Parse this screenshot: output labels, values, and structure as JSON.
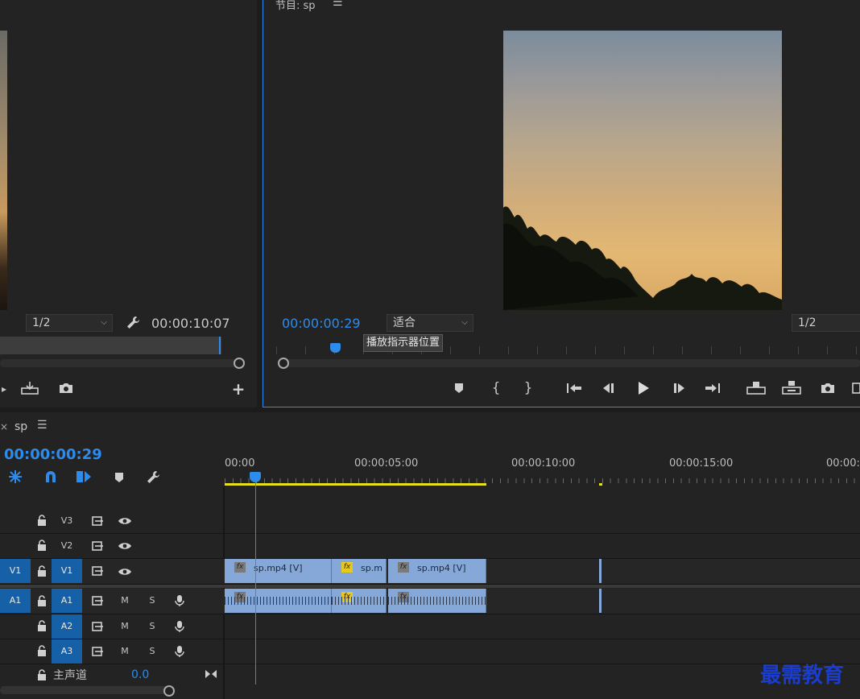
{
  "source_monitor": {
    "zoom": "1/2",
    "timecode": "00:00:10:07"
  },
  "program_monitor": {
    "title": "节目: sp",
    "timecode": "00:00:00:29",
    "fit": "适合",
    "zoom": "1/2",
    "tooltip": "播放指示器位置"
  },
  "timeline": {
    "sequence_name": "sp",
    "timecode": "00:00:00:29",
    "ruler": [
      "00:00",
      "00:00:05:00",
      "00:00:10:00",
      "00:00:15:00",
      "00:00:2"
    ],
    "tracks": {
      "video": [
        {
          "source": "",
          "name": "V3",
          "mute": "",
          "solo": ""
        },
        {
          "source": "",
          "name": "V2",
          "mute": "",
          "solo": ""
        },
        {
          "source": "V1",
          "name": "V1",
          "mute": "",
          "solo": ""
        }
      ],
      "audio": [
        {
          "source": "A1",
          "name": "A1",
          "mute": "M",
          "solo": "S"
        },
        {
          "source": "",
          "name": "A2",
          "mute": "M",
          "solo": "S"
        },
        {
          "source": "",
          "name": "A3",
          "mute": "M",
          "solo": "S"
        }
      ],
      "master": {
        "label": "主声道",
        "value": "0.0"
      }
    },
    "clips": {
      "v1_a": "sp.mp4 [V]",
      "v1_b": "sp.m",
      "v1_c": "sp.mp4 [V]"
    }
  },
  "watermark": "最需教育",
  "colors": {
    "accent": "#2d8ceb",
    "track_blue": "#1660a7",
    "clip": "#86a8d8",
    "work_area": "#e8e01a"
  }
}
